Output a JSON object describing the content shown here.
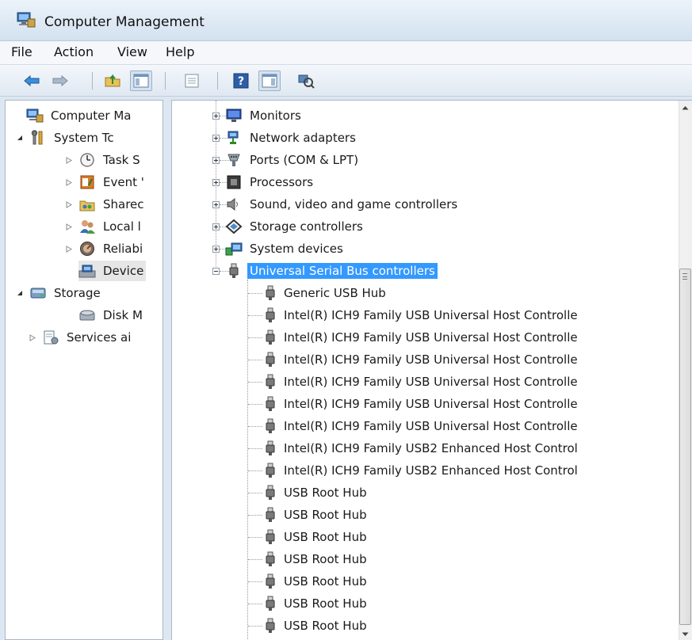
{
  "window": {
    "title": "Computer Management"
  },
  "menu": [
    "File",
    "Action",
    "View",
    "Help"
  ],
  "toolbar": {
    "buttons": [
      "back-arrow-icon",
      "forward-arrow-icon",
      "up-folder-icon",
      "show-hide-console-tree-icon",
      "properties-icon",
      "help-icon",
      "show-hide-action-pane-icon",
      "scan-hardware-icon"
    ]
  },
  "left_tree": [
    {
      "label": "Computer Ma",
      "icon": "computer-management-icon"
    },
    {
      "label": "System Tc",
      "icon": "system-tools-icon"
    },
    {
      "label": "Task S",
      "icon": "task-scheduler-icon"
    },
    {
      "label": "Event '",
      "icon": "event-viewer-icon"
    },
    {
      "label": "Sharec",
      "icon": "shared-folders-icon"
    },
    {
      "label": "Local l",
      "icon": "local-users-icon"
    },
    {
      "label": "Reliabi",
      "icon": "reliability-icon"
    },
    {
      "label": "Device",
      "icon": "device-manager-icon"
    },
    {
      "label": "Storage",
      "icon": "storage-icon"
    },
    {
      "label": "Disk M",
      "icon": "disk-management-icon"
    },
    {
      "label": "Services ai",
      "icon": "services-icon"
    }
  ],
  "device_categories": [
    {
      "label": "Monitors",
      "icon": "monitor-icon"
    },
    {
      "label": "Network adapters",
      "icon": "network-adapter-icon"
    },
    {
      "label": "Ports (COM & LPT)",
      "icon": "port-icon"
    },
    {
      "label": "Processors",
      "icon": "processor-icon"
    },
    {
      "label": "Sound, video and game controllers",
      "icon": "speaker-icon"
    },
    {
      "label": "Storage controllers",
      "icon": "storage-controller-icon"
    },
    {
      "label": "System devices",
      "icon": "system-devices-icon"
    },
    {
      "label": "Universal Serial Bus controllers",
      "icon": "usb-icon"
    }
  ],
  "usb_devices": [
    "Generic USB Hub",
    "Intel(R) ICH9 Family USB Universal Host Controlle",
    "Intel(R) ICH9 Family USB Universal Host Controlle",
    "Intel(R) ICH9 Family USB Universal Host Controlle",
    "Intel(R) ICH9 Family USB Universal Host Controlle",
    "Intel(R) ICH9 Family USB Universal Host Controlle",
    "Intel(R) ICH9 Family USB Universal Host Controlle",
    "Intel(R) ICH9 Family USB2 Enhanced Host Control",
    "Intel(R) ICH9 Family USB2 Enhanced Host Control",
    "USB Root Hub",
    "USB Root Hub",
    "USB Root Hub",
    "USB Root Hub",
    "USB Root Hub",
    "USB Root Hub",
    "USB Root Hub"
  ],
  "colors": {
    "selection": "#3399ff",
    "window_bg": "#dce7f2"
  }
}
